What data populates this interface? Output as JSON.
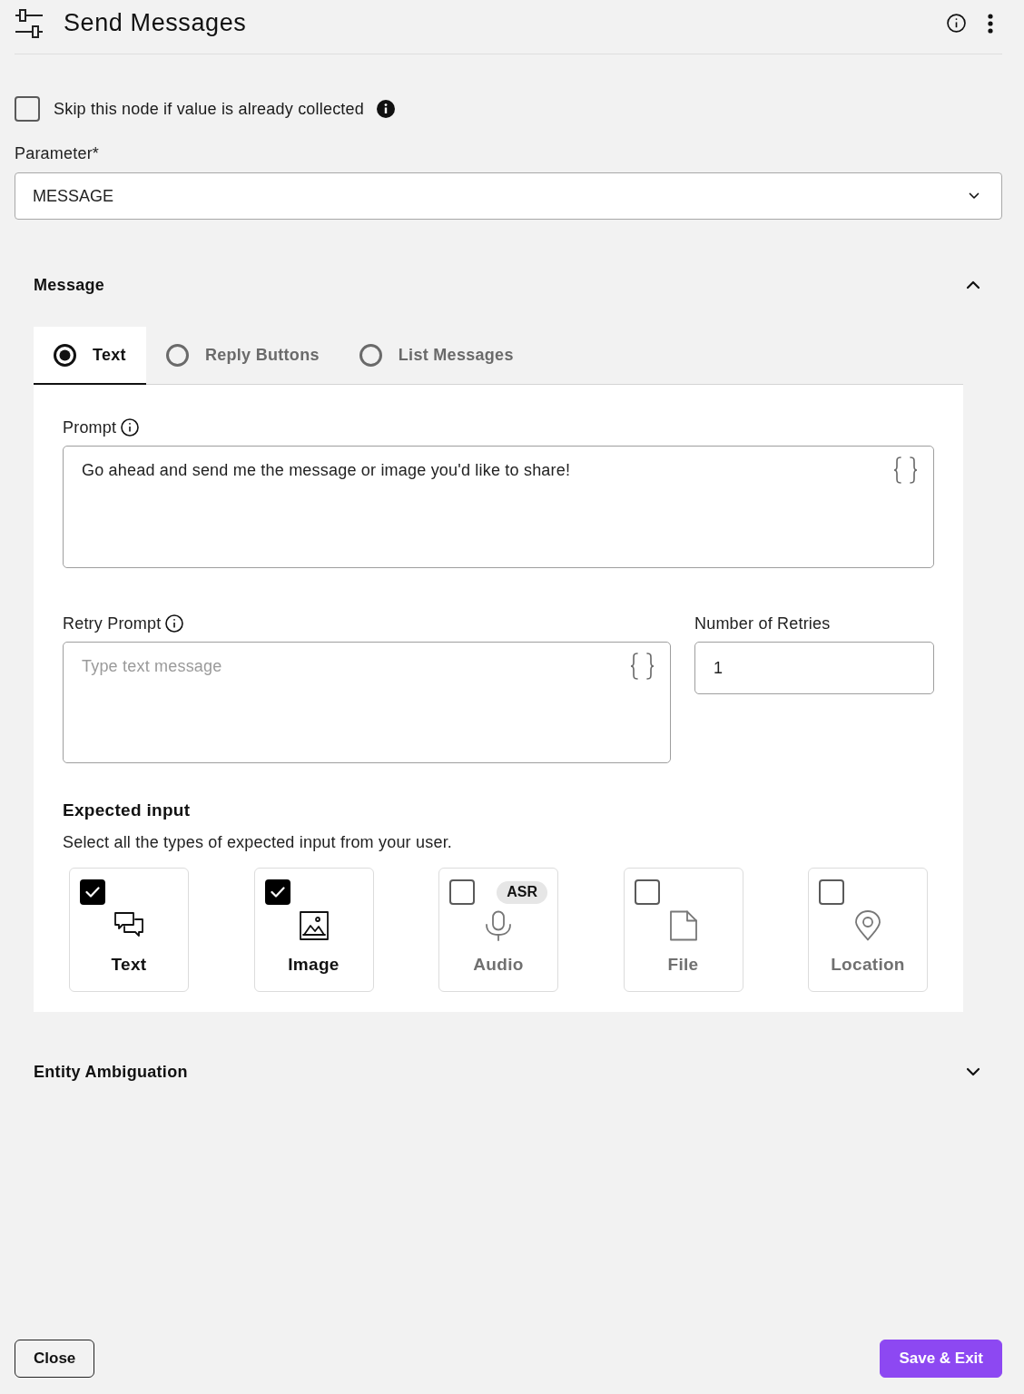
{
  "header": {
    "title": "Send Messages"
  },
  "skip_node": {
    "label": "Skip this node if value is already collected",
    "checked": false
  },
  "parameter": {
    "label": "Parameter*",
    "value": "MESSAGE"
  },
  "message_section": {
    "title": "Message",
    "expanded": true,
    "tabs": [
      {
        "label": "Text",
        "selected": true
      },
      {
        "label": "Reply Buttons",
        "selected": false
      },
      {
        "label": "List Messages",
        "selected": false
      }
    ],
    "prompt": {
      "label": "Prompt",
      "value": "Go ahead and send me the message or image you'd like to share!"
    },
    "retry_prompt": {
      "label": "Retry Prompt",
      "placeholder": "Type text message"
    },
    "retries": {
      "label": "Number of Retries",
      "value": "1"
    },
    "expected_input": {
      "title": "Expected input",
      "description": "Select all the types of expected input from your user.",
      "options": [
        {
          "kind": "chat",
          "label": "Text",
          "checked": true
        },
        {
          "kind": "image",
          "label": "Image",
          "checked": true
        },
        {
          "kind": "audio",
          "label": "Audio",
          "checked": false,
          "badge": "ASR"
        },
        {
          "kind": "file",
          "label": "File",
          "checked": false
        },
        {
          "kind": "location",
          "label": "Location",
          "checked": false
        }
      ]
    }
  },
  "entity_section": {
    "title": "Entity Ambiguation",
    "expanded": false
  },
  "footer": {
    "buttons": [
      {
        "label": "Close",
        "kind": "secondary"
      },
      {
        "label": "Save & Exit",
        "kind": "primary"
      }
    ]
  }
}
